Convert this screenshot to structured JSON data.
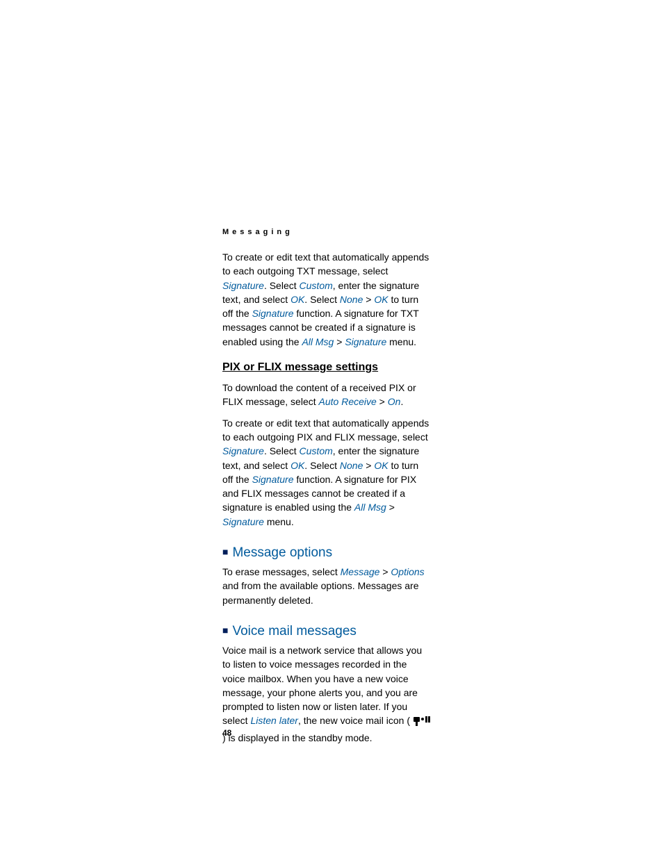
{
  "runningHead": "Messaging",
  "pageNumber": "48",
  "para1": {
    "t1": "To create or edit text that automatically appends to each outgoing TXT message, select ",
    "signature1": "Signature",
    "t2": ". Select ",
    "custom": "Custom",
    "t3": ", enter the signature text, and select ",
    "ok1": "OK",
    "t4": ". Select ",
    "none": "None",
    "gt1": " > ",
    "ok2": "OK",
    "t5": " to turn off the ",
    "signature2": "Signature",
    "t6": " function. A signature for TXT messages cannot be created if a signature is enabled using the ",
    "allmsg": "All Msg",
    "gt2": " > ",
    "signature3": "Signature",
    "t7": " menu."
  },
  "subheading1": "PIX or FLIX message settings",
  "para2": {
    "t1": "To download the content of a received PIX or FLIX message, select ",
    "autoReceive": "Auto Receive",
    "gt": " > ",
    "on": "On",
    "t2": "."
  },
  "para3": {
    "t1": "To create or edit text that automatically appends to each outgoing PIX and FLIX message, select ",
    "signature1": "Signature",
    "t2": ". Select ",
    "custom": "Custom",
    "t3": ", enter the signature text, and select ",
    "ok1": "OK",
    "t4": ". Select ",
    "none": "None",
    "gt1": " > ",
    "ok2": "OK",
    "t5": " to turn off the ",
    "signature2": "Signature",
    "t6": " function. A signature for PIX and FLIX messages cannot be created if a signature is enabled using the ",
    "allmsg": "All Msg",
    "gt2": " > ",
    "signature3": "Signature",
    "t7": " menu."
  },
  "section1": "Message options",
  "para4": {
    "t1": "To erase messages, select ",
    "message": "Message",
    "gt": " > ",
    "options": "Options",
    "t2": " and from the available options. Messages are permanently deleted."
  },
  "section2": "Voice mail messages",
  "para5": {
    "t1": "Voice mail is a network service that allows you to listen to voice messages recorded in the voice mailbox. When you have a new voice message, your phone alerts you, and you are prompted to listen now or listen later. If you select ",
    "listenLater": "Listen later",
    "t2": ", the new voice mail icon (",
    "t3": ") is displayed in the standby mode."
  }
}
